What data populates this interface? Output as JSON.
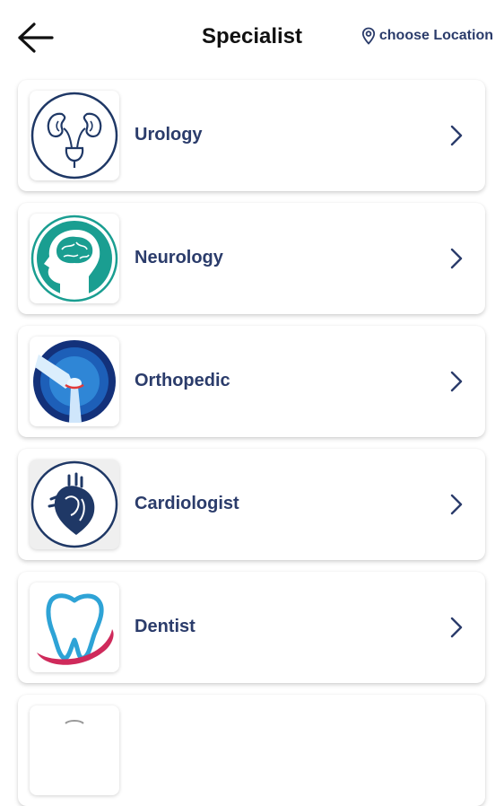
{
  "header": {
    "title": "Specialist",
    "location_label": "choose Location"
  },
  "specialists": [
    {
      "label": "Urology",
      "icon": "kidneys-icon"
    },
    {
      "label": "Neurology",
      "icon": "brain-head-icon"
    },
    {
      "label": "Orthopedic",
      "icon": "knee-joint-icon"
    },
    {
      "label": "Cardiologist",
      "icon": "heart-icon"
    },
    {
      "label": "Dentist",
      "icon": "tooth-icon"
    },
    {
      "label": "",
      "icon": "partial-icon"
    }
  ],
  "colors": {
    "accent": "#2b3c6b",
    "neurology_teal": "#1a9e91",
    "dentist_blue": "#2ea3d6",
    "dentist_pink": "#cf2a5b"
  }
}
